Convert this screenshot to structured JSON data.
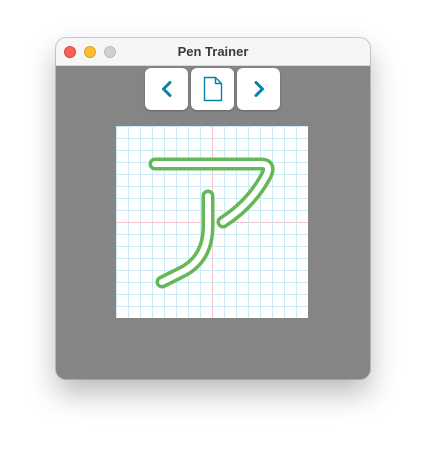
{
  "window": {
    "title": "Pen Trainer"
  },
  "toolbar": {
    "prev_icon": "chevron-left-icon",
    "page_icon": "document-icon",
    "next_icon": "chevron-right-icon"
  },
  "practice": {
    "character": "ア",
    "grid": true
  },
  "colors": {
    "accent": "#0a7fa8",
    "stroke_outline": "#64b856",
    "grid_minor": "#cbeaf3",
    "grid_center": "#f3c4cf",
    "background": "#858585"
  }
}
